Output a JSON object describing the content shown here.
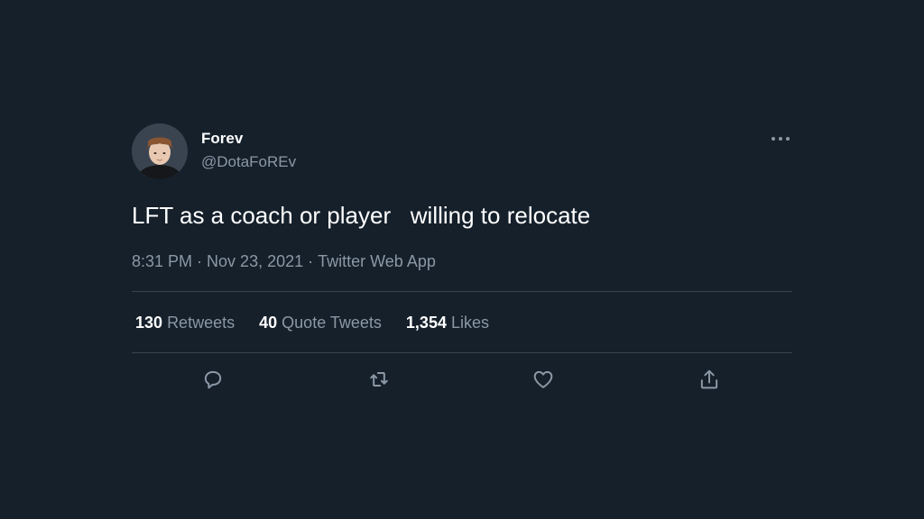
{
  "user": {
    "display_name": "Forev",
    "handle": "@DotaFoREv",
    "avatar_icon": "profile-photo"
  },
  "tweet": {
    "text": "LFT as a coach or player   willing to relocate",
    "time": "8:31 PM",
    "separator": "·",
    "date": "Nov 23, 2021",
    "source": "Twitter Web App"
  },
  "stats": {
    "retweets": {
      "count": "130",
      "label": "Retweets"
    },
    "quote_tweets": {
      "count": "40",
      "label": "Quote Tweets"
    },
    "likes": {
      "count": "1,354",
      "label": "Likes"
    }
  },
  "actions": [
    "reply-icon",
    "retweet-icon",
    "like-icon",
    "share-icon"
  ],
  "colors": {
    "background": "#15202b",
    "primary_text": "#ffffff",
    "secondary_text": "#8b98a5",
    "divider": "#38444d"
  }
}
